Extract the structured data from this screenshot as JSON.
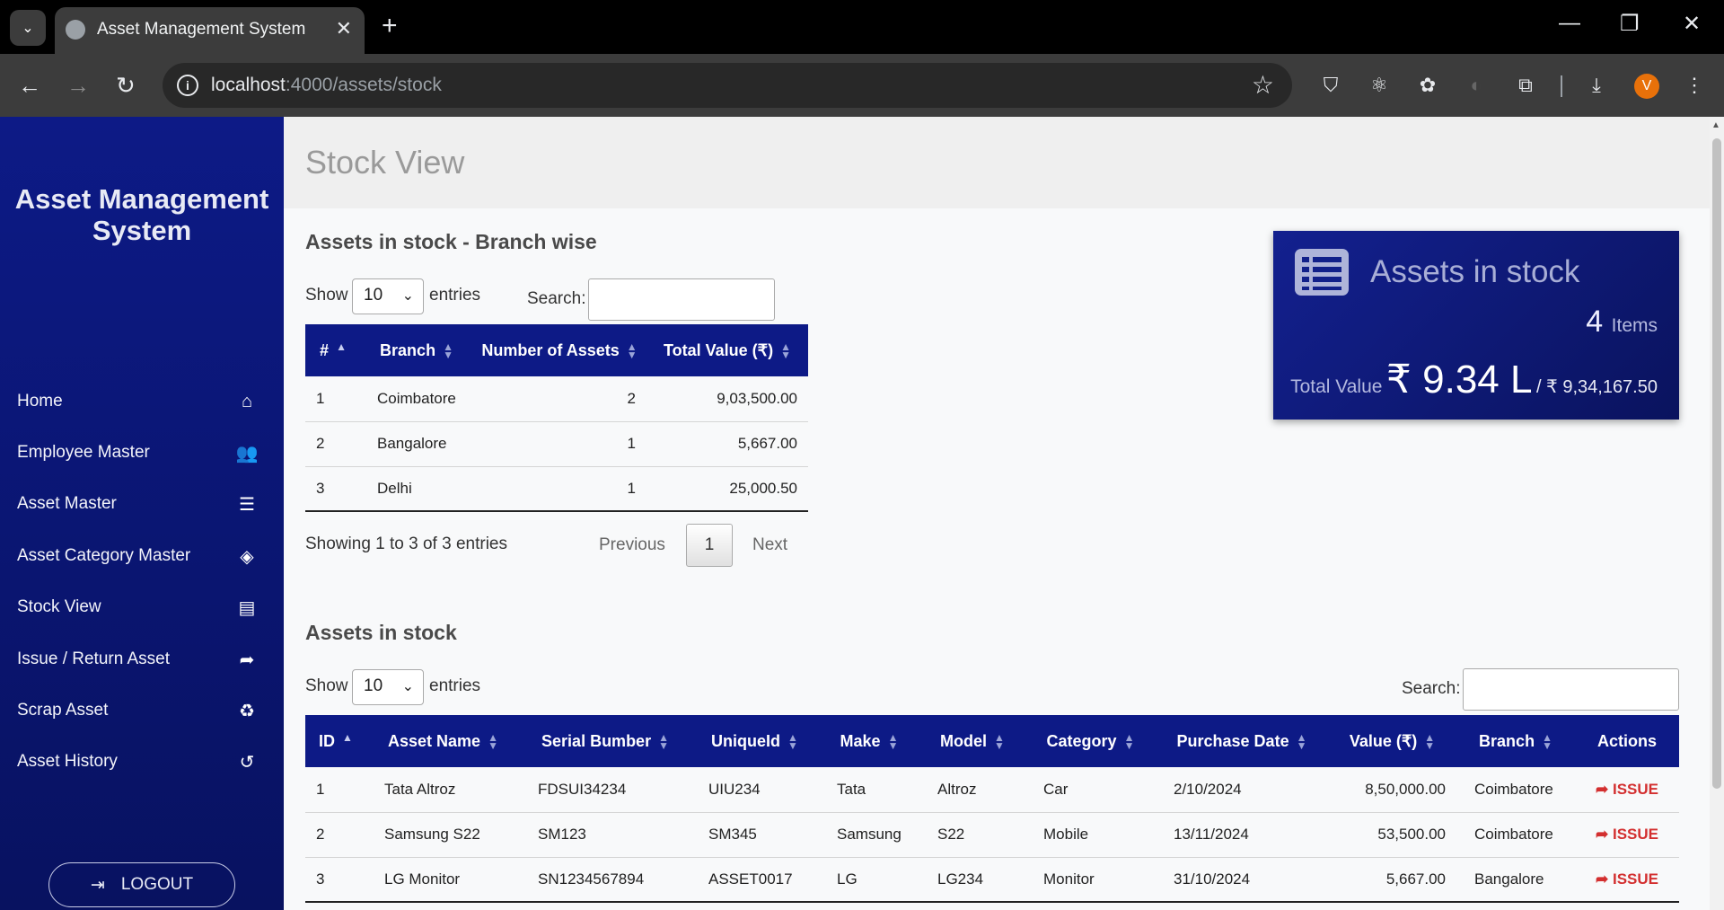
{
  "browser": {
    "tab_title": "Asset Management System",
    "url_host": "localhost",
    "url_path": ":4000/assets/stock",
    "profile_initial": "V"
  },
  "sidebar": {
    "brand": "Asset Management System",
    "items": [
      {
        "label": "Home",
        "icon": "home-icon",
        "glyph": "⌂"
      },
      {
        "label": "Employee Master",
        "icon": "users-icon",
        "glyph": "👥"
      },
      {
        "label": "Asset Master",
        "icon": "list-icon",
        "glyph": "☰"
      },
      {
        "label": "Asset Category Master",
        "icon": "layers-icon",
        "glyph": "◈"
      },
      {
        "label": "Stock View",
        "icon": "table-icon",
        "glyph": "▤"
      },
      {
        "label": "Issue / Return Asset",
        "icon": "share-icon",
        "glyph": "➦"
      },
      {
        "label": "Scrap Asset",
        "icon": "recycle-icon",
        "glyph": "♻"
      },
      {
        "label": "Asset History",
        "icon": "history-icon",
        "glyph": "↺"
      }
    ],
    "logout_label": "LOGOUT"
  },
  "page": {
    "title": "Stock View"
  },
  "branch_section": {
    "title": "Assets in stock - Branch wise",
    "show_label": "Show",
    "entries_label": "entries",
    "page_length": "10",
    "search_label": "Search:",
    "columns": [
      "#",
      "Branch",
      "Number of Assets",
      "Total Value (₹)"
    ],
    "rows": [
      [
        "1",
        "Coimbatore",
        "2",
        "9,03,500.00"
      ],
      [
        "2",
        "Bangalore",
        "1",
        "5,667.00"
      ],
      [
        "3",
        "Delhi",
        "1",
        "25,000.50"
      ]
    ],
    "info": "Showing 1 to 3 of 3 entries",
    "prev_label": "Previous",
    "next_label": "Next",
    "current_page": "1"
  },
  "stat_card": {
    "title": "Assets in stock",
    "count": "4",
    "count_unit": "Items",
    "total_label": "Total Value",
    "total_short": "₹ 9.34 L",
    "total_full": "/ ₹ 9,34,167.50"
  },
  "stock_section": {
    "title": "Assets in stock",
    "show_label": "Show",
    "entries_label": "entries",
    "page_length": "10",
    "search_label": "Search:",
    "columns": [
      "ID",
      "Asset Name",
      "Serial Bumber",
      "UniqueId",
      "Make",
      "Model",
      "Category",
      "Purchase Date",
      "Value (₹)",
      "Branch",
      "Actions"
    ],
    "rows": [
      [
        "1",
        "Tata Altroz",
        "FDSUI34234",
        "UIU234",
        "Tata",
        "Altroz",
        "Car",
        "2/10/2024",
        "8,50,000.00",
        "Coimbatore",
        "ISSUE"
      ],
      [
        "2",
        "Samsung S22",
        "SM123",
        "SM345",
        "Samsung",
        "S22",
        "Mobile",
        "13/11/2024",
        "53,500.00",
        "Coimbatore",
        "ISSUE"
      ],
      [
        "3",
        "LG Monitor",
        "SN1234567894",
        "ASSET0017",
        "LG",
        "LG234",
        "Monitor",
        "31/10/2024",
        "5,667.00",
        "Bangalore",
        "ISSUE"
      ]
    ]
  },
  "colors": {
    "sidebar": "#0d1a86",
    "table_header": "#0d1a86",
    "issue_action": "#d32f2f"
  }
}
